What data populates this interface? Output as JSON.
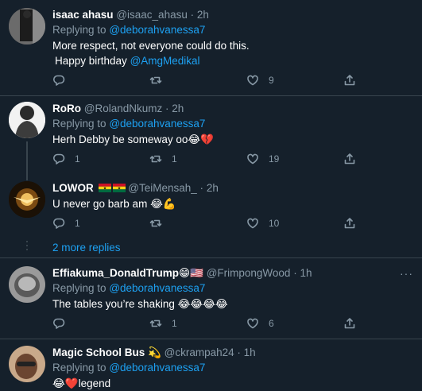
{
  "colors": {
    "background": "#15202b",
    "divider": "#38444d",
    "link": "#1da1f2",
    "muted": "#8899a6"
  },
  "tweets": [
    {
      "name": "isaac ahasu",
      "handle": "@isaac_ahasu",
      "time": "2h",
      "replying_prefix": "Replying to",
      "replying_to": "@deborahvanessa7",
      "text_line1": "More respect, not everyone could do this.",
      "text_line2_prefix": "Happy birthday",
      "text_line2_mention": "@AmgMedikal",
      "reply_count": "",
      "retweet_count": "",
      "like_count": "9"
    },
    {
      "name": "RoRo",
      "handle": "@RolandNkumz",
      "time": "2h",
      "replying_prefix": "Replying to",
      "replying_to": "@deborahvanessa7",
      "text": "Herh Debby be someway oo",
      "text_emoji": "😂💔",
      "reply_count": "1",
      "retweet_count": "1",
      "like_count": "19"
    },
    {
      "name": "LOWOR",
      "handle": "@TeiMensah_",
      "time": "2h",
      "text": "U never go barb am",
      "text_emoji": "😂💪",
      "reply_count": "1",
      "retweet_count": "",
      "like_count": "10"
    },
    {
      "more_replies": "2 more replies"
    },
    {
      "name": "Effiakuma_DonaldTrump",
      "name_emoji": "😁🇺🇸",
      "handle": "@FrimpongWood",
      "time": "1h",
      "replying_prefix": "Replying to",
      "replying_to": "@deborahvanessa7",
      "text": "The tables you’re shaking",
      "text_emoji": "😂😂😂😂",
      "reply_count": "",
      "retweet_count": "1",
      "like_count": "6"
    },
    {
      "name": "Magic School Bus",
      "name_emoji": "💫",
      "handle": "@ckrampah24",
      "time": "1h",
      "replying_prefix": "Replying to",
      "replying_to": "@deborahvanessa7",
      "text": "legend",
      "text_emoji": "😂❤️"
    }
  ],
  "separator": "·",
  "icons": [
    "reply-icon",
    "retweet-icon",
    "like-icon",
    "share-icon",
    "more-icon"
  ]
}
